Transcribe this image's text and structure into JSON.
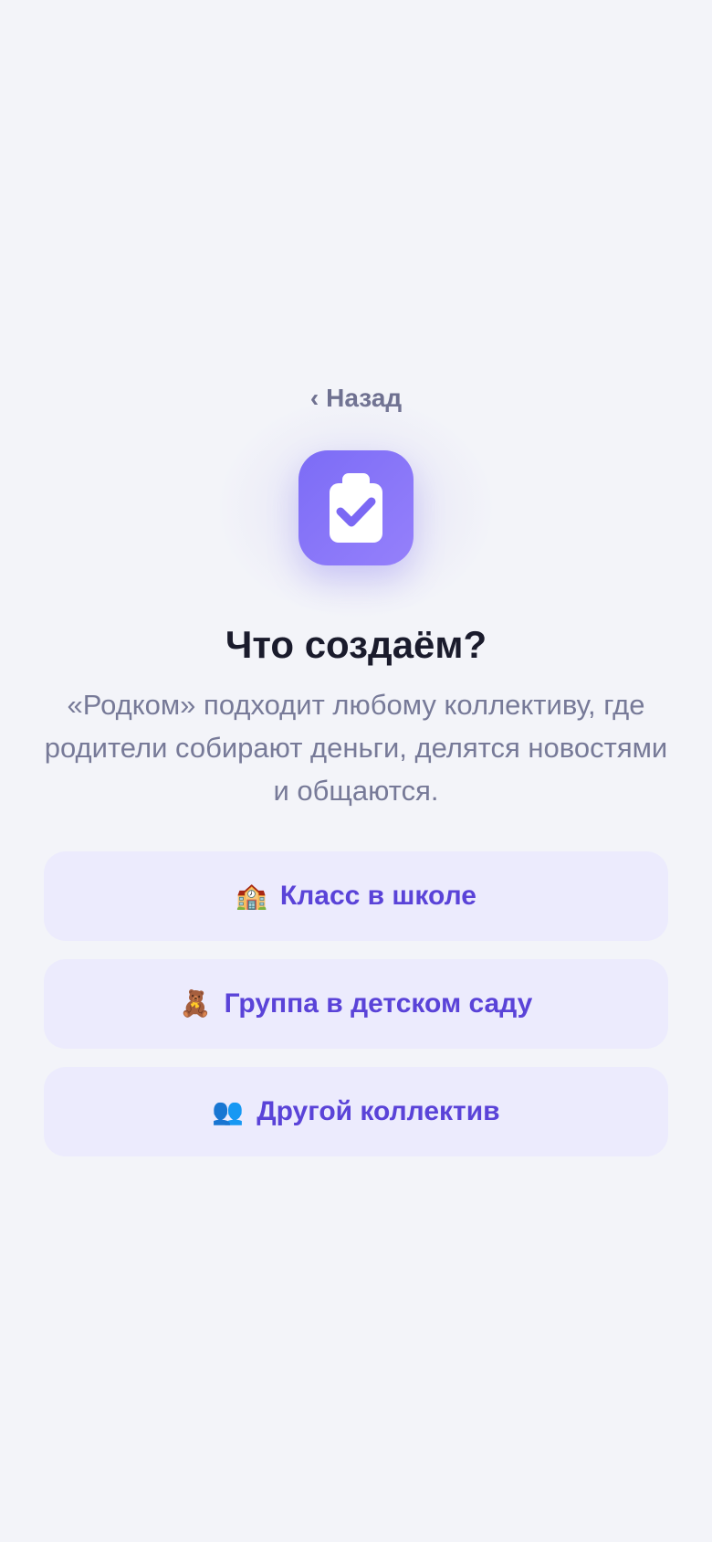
{
  "nav": {
    "back_chevron": "‹",
    "back_label": "Назад"
  },
  "hero": {
    "icon": "clipboard-check-icon",
    "title": "Что создаём?",
    "subtitle": "«Родком» подходит любому коллективу, где родители собирают деньги, делятся новостями и общаются."
  },
  "options": [
    {
      "emoji": "🏫",
      "icon": "school-icon",
      "label": "Класс в школе"
    },
    {
      "emoji": "🧸",
      "icon": "teddy-bear-icon",
      "label": "Группа в детском саду"
    },
    {
      "emoji": "👥",
      "icon": "people-icon",
      "label": "Другой коллектив"
    }
  ],
  "colors": {
    "background": "#f3f4f9",
    "accent": "#5a43d8",
    "icon_gradient_start": "#7c6cf6",
    "icon_gradient_end": "#9580fb",
    "option_background": "#ecebfd",
    "title": "#1a1b2c",
    "muted_text": "#777a98"
  }
}
